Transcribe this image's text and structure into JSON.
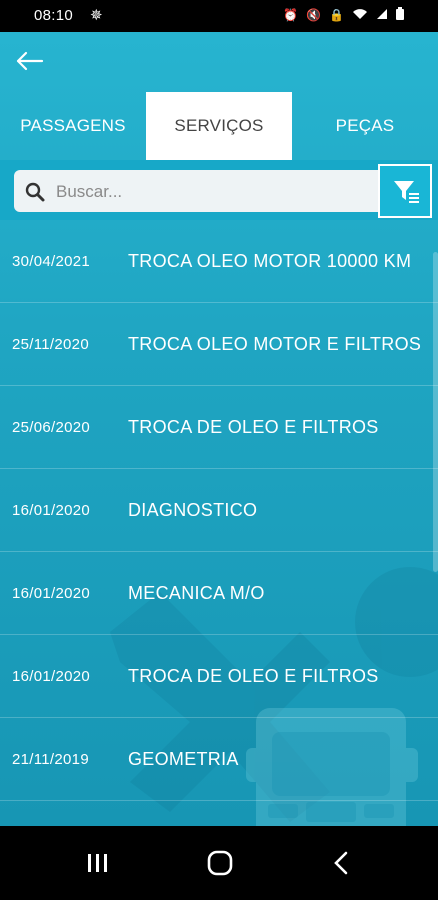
{
  "status_bar": {
    "time": "08:10",
    "icons": [
      "debug-icon",
      "alarm-icon",
      "mute-icon",
      "lock-icon",
      "wifi-icon",
      "signal-icon",
      "battery-icon"
    ]
  },
  "header": {
    "back_icon": "back-arrow-icon"
  },
  "tabs": [
    {
      "label": "PASSAGENS",
      "active": false
    },
    {
      "label": "SERVIÇOS",
      "active": true
    },
    {
      "label": "PEÇAS",
      "active": false
    }
  ],
  "search": {
    "placeholder": "Buscar...",
    "value": ""
  },
  "services": [
    {
      "date": "30/04/2021",
      "description": "TROCA OLEO MOTOR 10000 KM"
    },
    {
      "date": "25/11/2020",
      "description": "TROCA OLEO MOTOR E FILTROS"
    },
    {
      "date": "25/06/2020",
      "description": "TROCA DE OLEO E FILTROS"
    },
    {
      "date": "16/01/2020",
      "description": "DIAGNOSTICO"
    },
    {
      "date": "16/01/2020",
      "description": "MECANICA M/O"
    },
    {
      "date": "16/01/2020",
      "description": "TROCA DE OLEO E FILTROS"
    },
    {
      "date": "21/11/2019",
      "description": "GEOMETRIA"
    }
  ],
  "colors": {
    "accent": "#1fa5c2",
    "tab_active_bg": "#ffffff",
    "text": "#ffffff"
  }
}
